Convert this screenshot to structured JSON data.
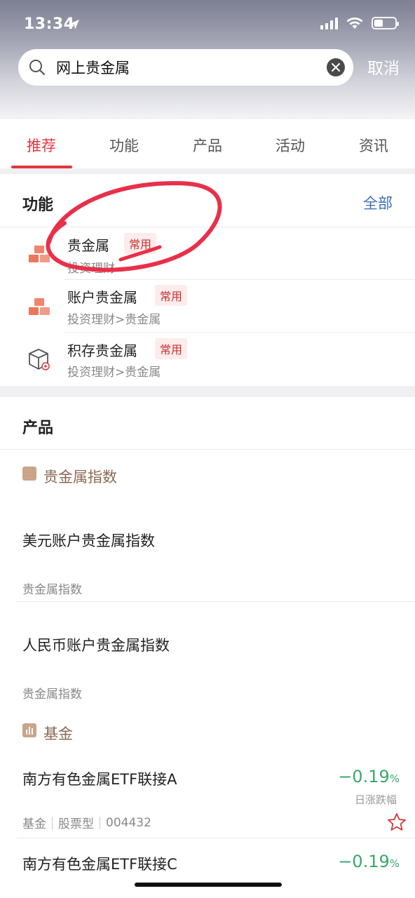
{
  "status_bar": {
    "time": "13:34"
  },
  "search": {
    "value": "网上贵金属",
    "cancel_label": "取消"
  },
  "tabs": [
    {
      "label": "推荐",
      "active": true
    },
    {
      "label": "功能",
      "active": false
    },
    {
      "label": "产品",
      "active": false
    },
    {
      "label": "活动",
      "active": false
    },
    {
      "label": "资讯",
      "active": false
    }
  ],
  "functions": {
    "title": "功能",
    "all_label": "全部",
    "items": [
      {
        "name": "贵金属",
        "badge": "常用",
        "path": "投资理财"
      },
      {
        "name": "账户贵金属",
        "badge": "常用",
        "path": "投资理财>贵金属"
      },
      {
        "name": "积存贵金属",
        "badge": "常用",
        "path": "投资理财>贵金属"
      }
    ]
  },
  "products": {
    "title": "产品",
    "category_index": "贵金属指数",
    "index_items": [
      {
        "name": "美元账户贵金属指数",
        "sub": "贵金属指数"
      },
      {
        "name": "人民币账户贵金属指数",
        "sub": "贵金属指数"
      }
    ],
    "category_fund": "基金",
    "funds": [
      {
        "name": "南方有色金属ETF联接A",
        "change": "−0.19",
        "unit": "%",
        "change_label": "日涨跌幅",
        "tags": [
          "基金",
          "股票型",
          "004432"
        ]
      },
      {
        "name": "南方有色金属ETF联接C",
        "change": "−0.19",
        "unit": "%"
      }
    ]
  },
  "colors": {
    "accent": "#e0383e",
    "link": "#3b6fb5",
    "down": "#3aa86b",
    "badge_bg": "#fdeceb"
  }
}
